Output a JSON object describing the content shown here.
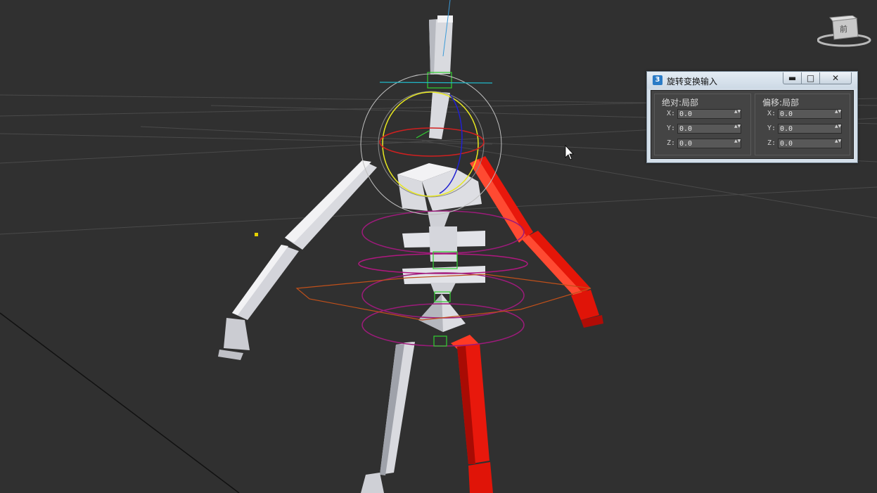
{
  "dialog": {
    "title": "旋转变换输入",
    "icon": "3ds-max-icon",
    "buttons": {
      "minimize": "▬",
      "maximize": "□",
      "close": "✕"
    },
    "absolute": {
      "title": "绝对:局部",
      "x_label": "X:",
      "x_value": "0.0",
      "y_label": "Y:",
      "y_value": "0.0",
      "z_label": "Z:",
      "z_value": "0.0"
    },
    "offset": {
      "title": "偏移:局部",
      "x_label": "X:",
      "x_value": "0.0",
      "y_label": "Y:",
      "y_value": "0.0",
      "z_label": "Z:",
      "z_value": "0.0"
    },
    "spinner_arrows": "▲▼"
  },
  "viewcube": {
    "label": "前"
  },
  "colors": {
    "viewport_bg": "#303030",
    "bone": "#dcdde2",
    "selected_bone": "#e8180c",
    "gizmo_x": "#d02020",
    "gizmo_y": "#e0e020",
    "gizmo_z": "#2020d0",
    "bip_ring": "#b01880"
  }
}
